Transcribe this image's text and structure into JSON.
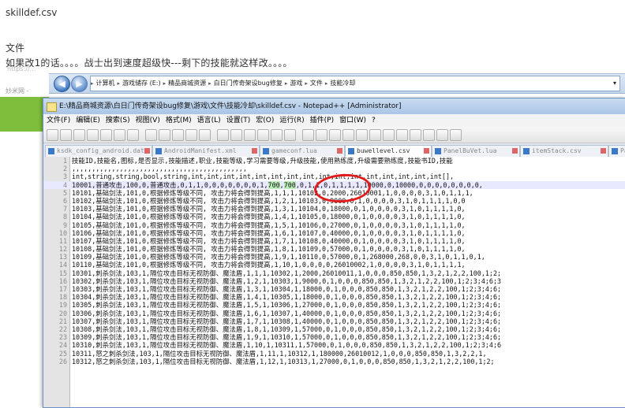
{
  "post": {
    "title": "skilldef.csv",
    "para1": "文件",
    "para2": "如果改1的话。。。。战士出到速度超级快---剩下的技能就这样改。。。。",
    "bg_fragment1": "https://...",
    "bg_fragment2": "妙米网 -"
  },
  "explorer": {
    "back_glyph": "◀",
    "forward_glyph": "▶",
    "path": [
      "计算机",
      "游戏储存 (E:)",
      "精品商城资源",
      "白日门传奇架设bug修复",
      "游戏",
      "文件",
      "技能冷却"
    ],
    "separator": "▸",
    "dropdown": "▾"
  },
  "npp": {
    "title": "E:\\精品商城资源\\白日门传奇架设bug修复\\游戏\\文件\\技能冷却\\skilldef.csv - Notepad++ [Administrator]",
    "menu": [
      "文件(F)",
      "编辑(E)",
      "搜索(S)",
      "视图(V)",
      "格式(M)",
      "语言(L)",
      "设置(T)",
      "宏(O)",
      "运行(R)",
      "插件(P)",
      "窗口(W)",
      "?"
    ],
    "tabs": [
      "ksdk_config_android.data",
      "AndroidManifest.xml",
      "gameconf.lua",
      "buwellevel.csv",
      "PanelBuVet.lua",
      "itemStack.csv",
      "PanelZhuan"
    ],
    "active_tab": 3
  },
  "editor": {
    "current_line": 4,
    "highlight": {
      "line": 4,
      "before": "10001,普通攻击,100,0,普通攻击,0,1,1,0,0,0,0,0,0,0,1,",
      "a": "700",
      "sep": ",",
      "b": "700",
      "after": ",0,1,1,0,1,1,1,1,10000,0,10000,0,0,0,0,0,0,0,0,"
    },
    "lines": [
      "技能ID,技能名,图标,是否显示,技能描述,职业,技能等级,学习需要等级,升级技能,使用熟练度,升级需要熟练度,技能书ID,技能",
      ",,,,,,,,,,,,,,,,,,,,,,,,,,,,,,,,,,,,,,,,,,,,",
      "int,string,string,bool,string,int,int,int,int,int,int,int,int,int,int,int,int,int,int,int,int[],",
      "",
      "10101,基础剑法,101,0,根据修炼等级不同, 攻击力将会得到提高,1,1,1,10102,0,2000,26010001,1,0,0,0,0,3,1,0,1,1,1,",
      "10102,基础剑法,101,0,根据修炼等级不同, 攻击力将会得到提高,1,2,1,10103,0,9000,0,1,0,0,0,0,3,1,0,1,1,1,1,0,0",
      "10103,基础剑法,101,0,根据修炼等级不同, 攻击力将会得到提高,1,3,1,10104,0,18000,0,1,0,0,0,0,3,1,0,1,1,1,1,0,",
      "10104,基础剑法,101,0,根据修炼等级不同, 攻击力将会得到提高,1,4,1,10105,0,18000,0,1,0,0,0,0,3,1,0,1,1,1,1,0,",
      "10105,基础剑法,101,0,根据修炼等级不同, 攻击力将会得到提高,1,5,1,10106,0,27000,0,1,0,0,0,0,3,1,0,1,1,1,1,0,",
      "10106,基础剑法,101,0,根据修炼等级不同, 攻击力将会得到提高,1,6,1,10107,0,40000,0,1,0,0,0,0,3,1,0,1,1,1,1,0,",
      "10107,基础剑法,101,0,根据修炼等级不同, 攻击力将会得到提高,1,7,1,10108,0,40000,0,1,0,0,0,0,3,1,0,1,1,1,1,0,",
      "10108,基础剑法,101,0,根据修炼等级不同, 攻击力将会得到提高,1,8,1,10109,0,57000,0,1,0,0,0,0,3,1,0,1,1,1,1,0,",
      "10109,基础剑法,101,0,根据修炼等级不同, 攻击力将会得到提高,1,9,1,10110,0,57000,0,1,268000,268,0,0,3,1,0,1,1,0,1,",
      "10110,基础剑法,101,0,根据修炼等级不同, 攻击力将会得到提高,1,10,1,0,0,0,0,26010002,1,0,0,0,0,3,1,0,1,1,1,1,",
      "10301,刺杀剑法,103,1,隔位攻击目标无视防御、魔法盾,1,1,1,10302,1,2000,26010011,1,0,0,0,850,850,1,3,2,1,2,2,100,1;2;",
      "10302,刺杀剑法,103,1,隔位攻击目标无视防御、魔法盾,1,2,1,10303,1,9000,0,1,0,0,0,850,850,1,3,2,1,2,2,100,1;2;3;4;6;3",
      "10303,刺杀剑法,103,1,隔位攻击目标无视防御、魔法盾,1,3,1,10304,1,18000,0,1,0,0,0,850,850,1,3,2,1,2,2,100,1;2;3;4;6;",
      "10304,刺杀剑法,103,1,隔位攻击目标无视防御、魔法盾,1,4,1,10305,1,18000,0,1,0,0,0,850,850,1,3,2,1,2,2,100,1;2;3;4;6;",
      "10305,刺杀剑法,103,1,隔位攻击目标无视防御、魔法盾,1,5,1,10306,1,27000,0,1,0,0,0,850,850,1,3,2,1,2,2,100,1;2;3;4;6;",
      "10306,刺杀剑法,103,1,隔位攻击目标无视防御、魔法盾,1,6,1,10307,1,40000,0,1,0,0,0,850,850,1,3,2,1,2,2,100,1;2;3;4;6;",
      "10307,刺杀剑法,103,1,隔位攻击目标无视防御、魔法盾,1,7,1,10308,1,40000,0,1,0,0,0,850,850,1,3,2,1,2,2,100,1;2;3;4;6;",
      "10308,刺杀剑法,103,1,隔位攻击目标无视防御、魔法盾,1,8,1,10309,1,57000,0,1,0,0,0,850,850,1,3,2,1,2,2,100,1;2;3;4;6;",
      "10309,刺杀剑法,103,1,隔位攻击目标无视防御、魔法盾,1,9,1,10310,1,57000,0,1,0,0,0,850,850,1,3,2,1,2,2,100,1;2;3;4;6;",
      "10310,刺杀剑法,103,1,隔位攻击目标无视防御、魔法盾,1,10,1,10311,1,57000,0,1,0,0,0,850,850,1,3,2,1,2,2,100,1;2;3;4;6",
      "10311,怒之刺杀剑法,103,1,隔位攻击目标无视防御、魔法盾,1,11,1,10312,1,180000,26010012,1,0,0,0,850,850,1,3,2,2,1,",
      "10312,怒之刺杀剑法,103,1,隔位攻击目标无视防御、魔法盾,1,12,1,10313,1,27000,0,1,0,0,0,850,850,1,3,2,1,2,2,100,1;2;"
    ]
  },
  "colors": {
    "annotation": "#e01d1d",
    "highlight": "#bbeebb",
    "green_strip": "#7fbe3c"
  }
}
